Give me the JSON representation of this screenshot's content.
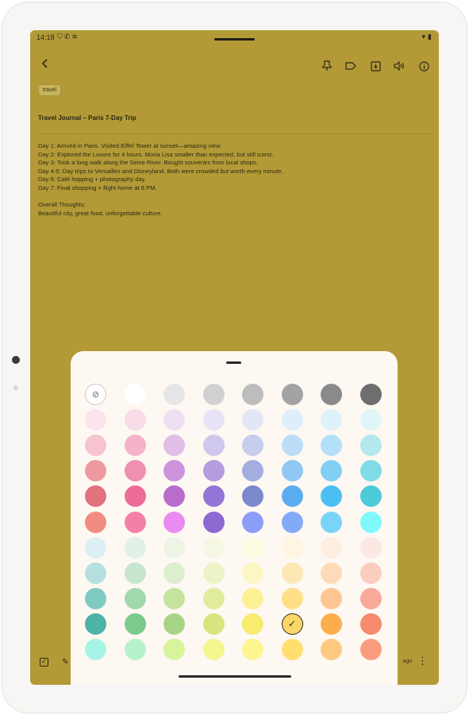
{
  "status_bar": {
    "time": "14:18",
    "left_icons": [
      "shield-icon",
      "phone-icon",
      "signal-icon"
    ],
    "right_icons": [
      "wifi-icon",
      "battery-icon"
    ]
  },
  "toolbar": {
    "back_icon": "arrow-left-icon",
    "actions": [
      "pin-icon",
      "label-icon",
      "archive-icon",
      "speaker-icon",
      "info-icon"
    ]
  },
  "note": {
    "tag": "travel",
    "title": "Travel Journal – Paris 7-Day Trip",
    "body": "Day 1: Arrived in Paris. Visited Eiffel Tower at sunset—amazing view.\nDay 2: Explored the Louvre for 4 hours. Mona Lisa smaller than expected, but still iconic.\nDay 3: Took a long walk along the Seine River. Bought souvenirs from local shops.\nDay 4-5: Day trips to Versailles and Disneyland. Both were crowded but worth every minute.\nDay 6: Café hopping + photography day.\nDay 7: Final shopping + flight home at 8 PM.\n\nOverall Thoughts:\nBeautiful city, great food, unforgettable culture."
  },
  "bottom_bar": {
    "edited": "ago",
    "left_icons": [
      "checkbox-icon",
      "palette-icon"
    ],
    "more_icon": "more-vert-icon"
  },
  "color_picker": {
    "default_icon": "color-off-icon",
    "selected_row": 9,
    "selected_col": 5,
    "rows": [
      [
        "#ffffff",
        "#ffffff",
        "#e6e6e6",
        "#d1d1d1",
        "#bdbdbd",
        "#a3a3a3",
        "#8a8a8a",
        "#6e6e6e"
      ],
      [
        "#fbe4ec",
        "#f8dce8",
        "#eedff3",
        "#e8e3f5",
        "#e3e6f6",
        "#dfeefb",
        "#ddf1fb",
        "#dff5f7"
      ],
      [
        "#f7c3d1",
        "#f4b3cb",
        "#dfbfe8",
        "#d0c7ec",
        "#c7cdee",
        "#bddcf8",
        "#b4e1f9",
        "#b3e8ef"
      ],
      [
        "#ec9aa0",
        "#ef8fb1",
        "#cd94dc",
        "#b39ddf",
        "#a4ade0",
        "#90c7f4",
        "#82cff5",
        "#7fdbe5"
      ],
      [
        "#e2727d",
        "#ec6d99",
        "#b86ccb",
        "#9276d6",
        "#7b88cc",
        "#5aadf0",
        "#4bbff2",
        "#4ecbd9"
      ],
      [
        "#f28b80",
        "#f47fa8",
        "#e98bf0",
        "#8c6ad1",
        "#8c9df7",
        "#82abf7",
        "#79d4fa",
        "#7ff9fc"
      ],
      [
        "#dceff3",
        "#e2f1e6",
        "#eef4e4",
        "#f5f7e2",
        "#fdfbe0",
        "#fff5e1",
        "#fdeee0",
        "#fde7e3"
      ],
      [
        "#b6e0e0",
        "#c7e6d0",
        "#dceecd",
        "#ecf3c6",
        "#fbf6c2",
        "#fde7b5",
        "#fddbb8",
        "#fbcdbf"
      ],
      [
        "#7fcbc4",
        "#a2d9ac",
        "#c4e49e",
        "#e1ec9a",
        "#fcf195",
        "#ffdf85",
        "#fdc591",
        "#f9a99a"
      ],
      [
        "#4eb3a7",
        "#7dc98e",
        "#a8d585",
        "#d9e57e",
        "#f7ec6d",
        "#fbd769",
        "#fbae4b",
        "#f88a6e"
      ],
      [
        "#a6f5e4",
        "#b7f2cd",
        "#d7f49b",
        "#f3f78f",
        "#fdf590",
        "#ffdf70",
        "#fdc980",
        "#fb9c80"
      ]
    ]
  }
}
